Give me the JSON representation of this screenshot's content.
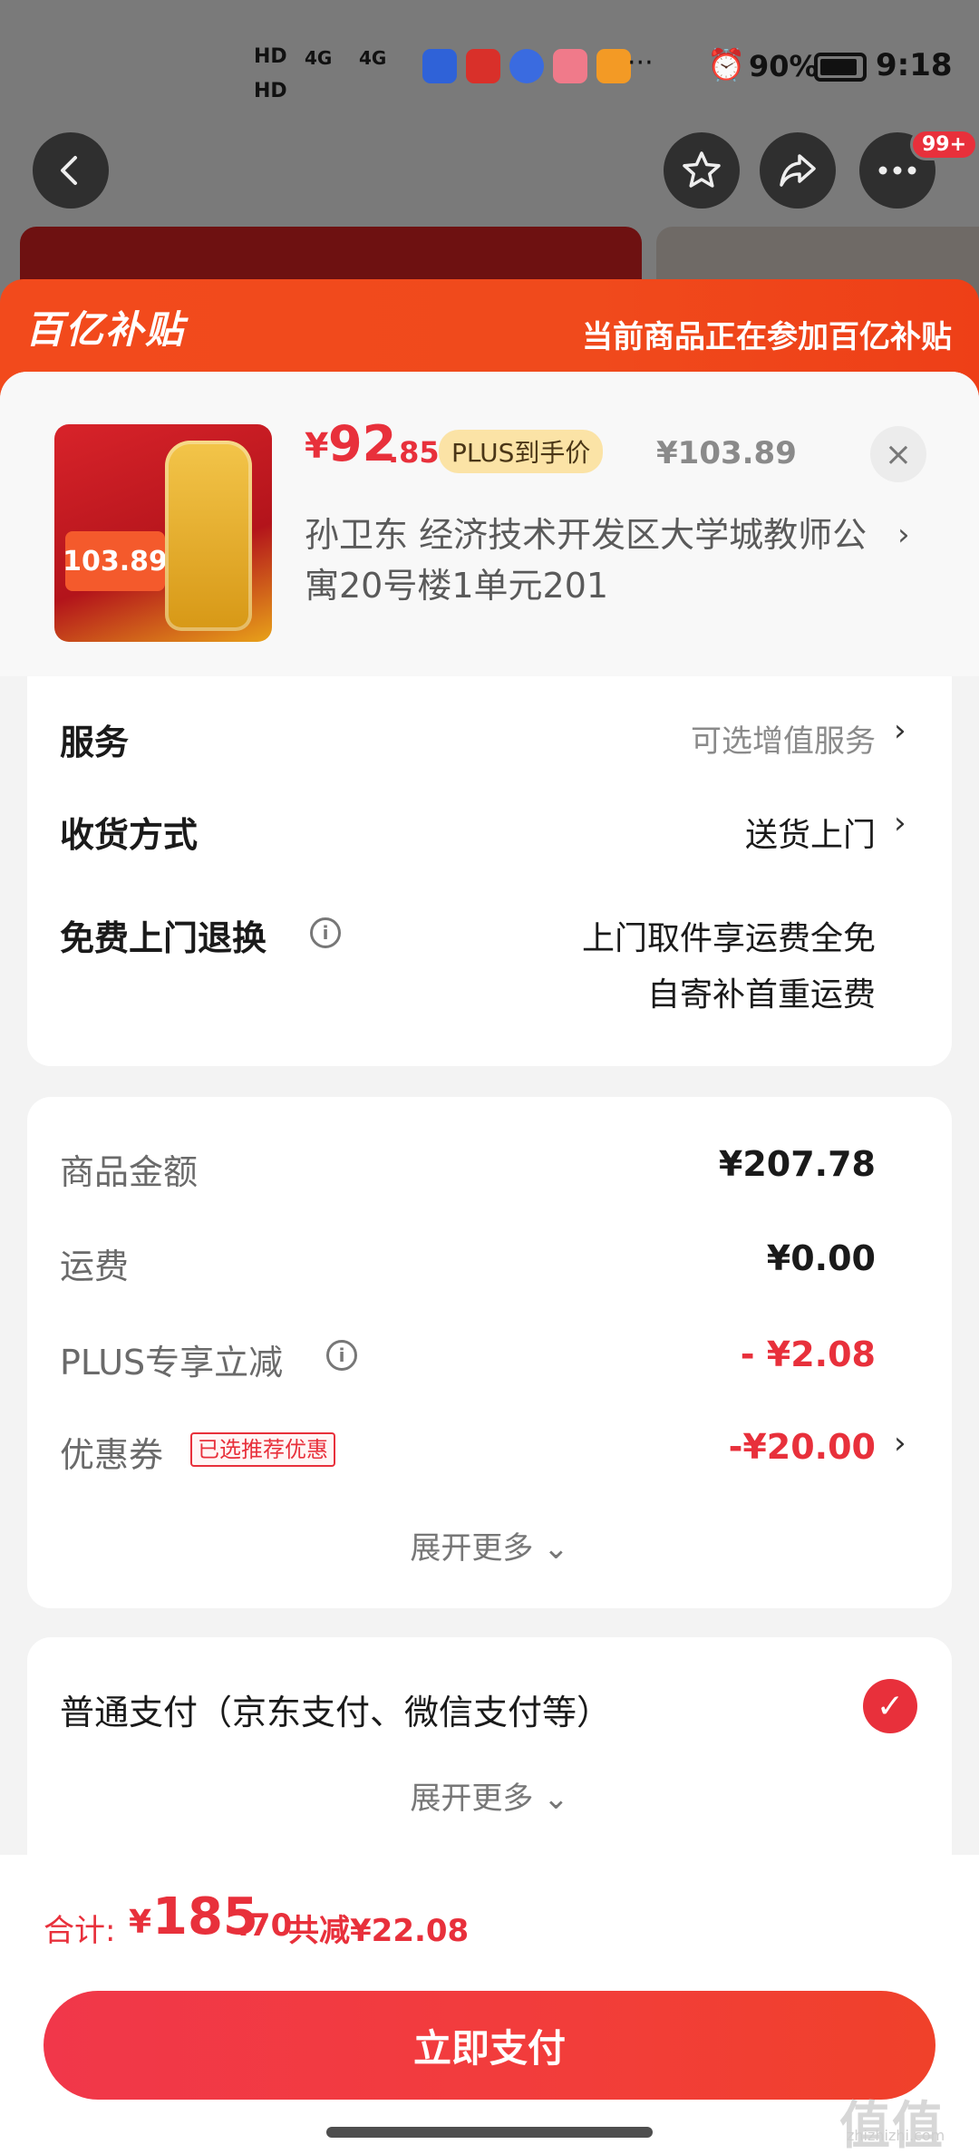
{
  "status_bar": {
    "hd1": "HD",
    "hd2": "HD",
    "signal1": "4G",
    "signal2": "4G",
    "more": "···",
    "battery": "90%",
    "time": "9:18",
    "app_colors": [
      "#2f62d8",
      "#d9302a",
      "#3a6be0",
      "#f07a8a",
      "#f39a25"
    ]
  },
  "nav": {
    "back_icon": "back-arrow-icon",
    "star_icon": "star-icon",
    "share_icon": "share-icon",
    "more_icon": "more-icon",
    "more_badge": "99+"
  },
  "sheet": {
    "logo": "百亿补贴",
    "tip": "当前商品正在参加百亿补贴"
  },
  "product": {
    "image_tag": "103.89",
    "price_currency": "¥",
    "price_int": "92",
    "price_dec": ".85",
    "plus_label": "PLUS到手价",
    "original_price": "¥103.89",
    "close_icon": "×",
    "address": "孙卫东  经济技术开发区大学城教师公寓20号楼1单元201"
  },
  "options": {
    "service_label": "服务",
    "service_value": "可选增值服务",
    "delivery_label": "收货方式",
    "delivery_value": "送货上门",
    "return_label": "免费上门退换",
    "return_line1": "上门取件享运费全免",
    "return_line2": "自寄补首重运费"
  },
  "summary": {
    "goods_label": "商品金额",
    "goods_value": "¥207.78",
    "shipping_label": "运费",
    "shipping_value": "¥0.00",
    "plus_label": "PLUS专享立减",
    "plus_value": "- ¥2.08",
    "coupon_label": "优惠券",
    "coupon_tag": "已选推荐优惠",
    "coupon_value": "-¥20.00",
    "expand": "展开更多"
  },
  "payment": {
    "method": "普通支付（京东支付、微信支付等）",
    "expand": "展开更多"
  },
  "footer": {
    "total_label": "合计:",
    "total_currency": "¥",
    "total_int": "185",
    "total_dec": ".70",
    "total_save": "共减¥22.08",
    "pay_button": "立即支付"
  },
  "watermark": {
    "text": "值值值",
    "sub": "zhizhizhi.com"
  },
  "colors": {
    "accent_red": "#e8303b",
    "banner_orange": "#f04a1c"
  }
}
